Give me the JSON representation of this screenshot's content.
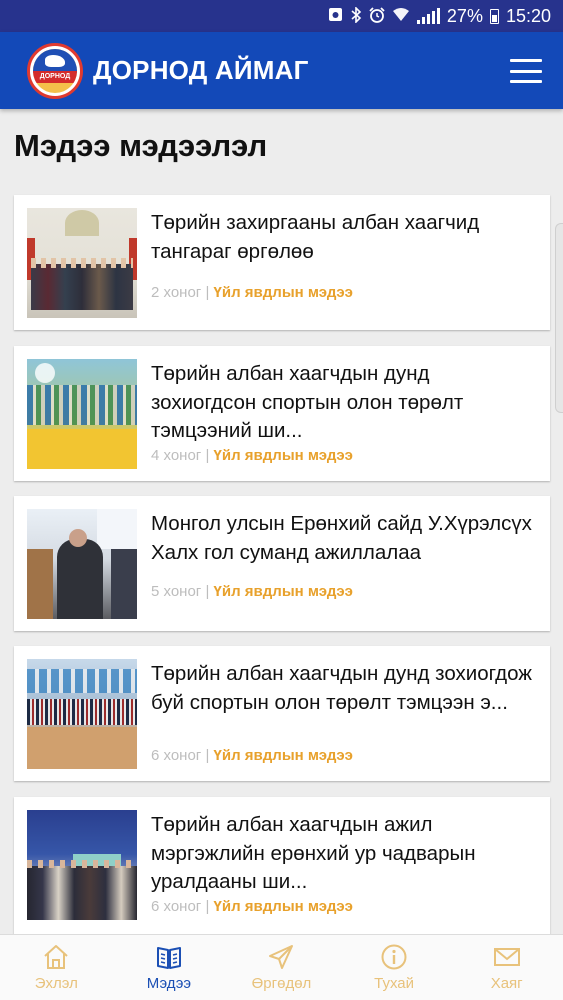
{
  "status_bar": {
    "battery_percent": "27%",
    "time": "15:20"
  },
  "app_bar": {
    "title": "ДОРНОД АЙМАГ",
    "logo_text": "ДОРНОД"
  },
  "page": {
    "title": "Мэдээ мэдээлэл"
  },
  "news": [
    {
      "headline": "Төрийн захиргааны албан хаагчид тангараг өргөлөө",
      "age": "2 хоног",
      "separator": "|",
      "category": "Үйл явдлын мэдээ"
    },
    {
      "headline": "Төрийн албан хаагчдын дунд зохиогдсон спортын олон төрөлт тэмцээний ши...",
      "age": "4 хоног",
      "separator": "|",
      "category": "Үйл явдлын мэдээ"
    },
    {
      "headline": "Монгол улсын Ерөнхий сайд У.Хүрэлсүх Халх гол суманд ажиллалаа",
      "age": "5 хоног",
      "separator": "|",
      "category": "Үйл явдлын мэдээ"
    },
    {
      "headline": "Төрийн албан хаагчдын дунд зохиогдож буй спортын олон төрөлт тэмцээн э...",
      "age": "6 хоног",
      "separator": "|",
      "category": "Үйл явдлын мэдээ"
    },
    {
      "headline": "Төрийн албан хаагчдын ажил мэргэжлийн ерөнхий ур чадварын уралдааны ши...",
      "age": "6 хоног",
      "separator": "|",
      "category": "Үйл явдлын мэдээ"
    }
  ],
  "bottom_nav": [
    {
      "label": "Эхлэл",
      "icon": "home-icon"
    },
    {
      "label": "Мэдээ",
      "icon": "book-icon",
      "active": true
    },
    {
      "label": "Өргөдөл",
      "icon": "send-icon"
    },
    {
      "label": "Тухай",
      "icon": "info-icon"
    },
    {
      "label": "Хаяг",
      "icon": "mail-icon"
    }
  ],
  "colors": {
    "app_bar": "#1349b8",
    "status_bar": "#27338d",
    "category_text": "#e8a12c",
    "nav_inactive": "#e8c27b",
    "nav_active": "#1b4fb4"
  }
}
